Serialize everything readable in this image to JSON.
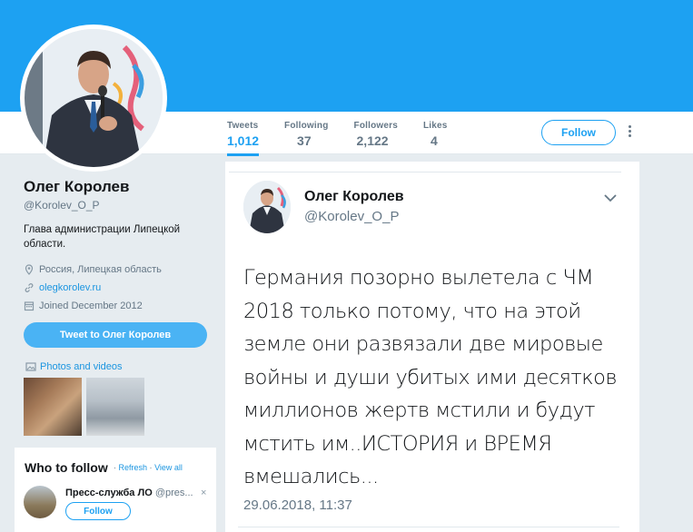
{
  "stats": [
    {
      "label": "Tweets",
      "value": "1,012"
    },
    {
      "label": "Following",
      "value": "37"
    },
    {
      "label": "Followers",
      "value": "2,122"
    },
    {
      "label": "Likes",
      "value": "4"
    }
  ],
  "follow_label": "Follow",
  "profile": {
    "name": "Олег Королев",
    "handle": "@Korolev_O_P",
    "bio": "Глава администрации Липецкой области.",
    "location": "Россия, Липецкая область",
    "website": "olegkorolev.ru",
    "joined": "Joined December 2012",
    "tweet_to_label": "Tweet to Олег Королев",
    "photos_label": "Photos and videos"
  },
  "who_to_follow": {
    "title": "Who to follow",
    "refresh": "Refresh",
    "view_all": "View all",
    "separator": "·",
    "account": {
      "name": "Пресс-служба ЛО",
      "handle": "@pres..."
    },
    "follow_label": "Follow",
    "dismiss": "×"
  },
  "tweet": {
    "name": "Олег Королев",
    "handle": "@Korolev_O_P",
    "text": "Германия позорно вылетела с ЧМ 2018 только потому, что на этой земле они развязали две мировые войны и души убитых ими десятков миллионов жертв мстили и будут мстить им..ИСТОРИЯ и ВРЕМЯ вмешались...",
    "date": "29.06.2018, 11:37"
  },
  "colors": {
    "accent": "#1da1f2",
    "banner": "#1da1f2",
    "page_bg": "#e6ecf0"
  },
  "icons": [
    "location-pin-icon",
    "link-icon",
    "calendar-icon",
    "photos-icon",
    "chevron-down-icon",
    "more-options-icon"
  ]
}
